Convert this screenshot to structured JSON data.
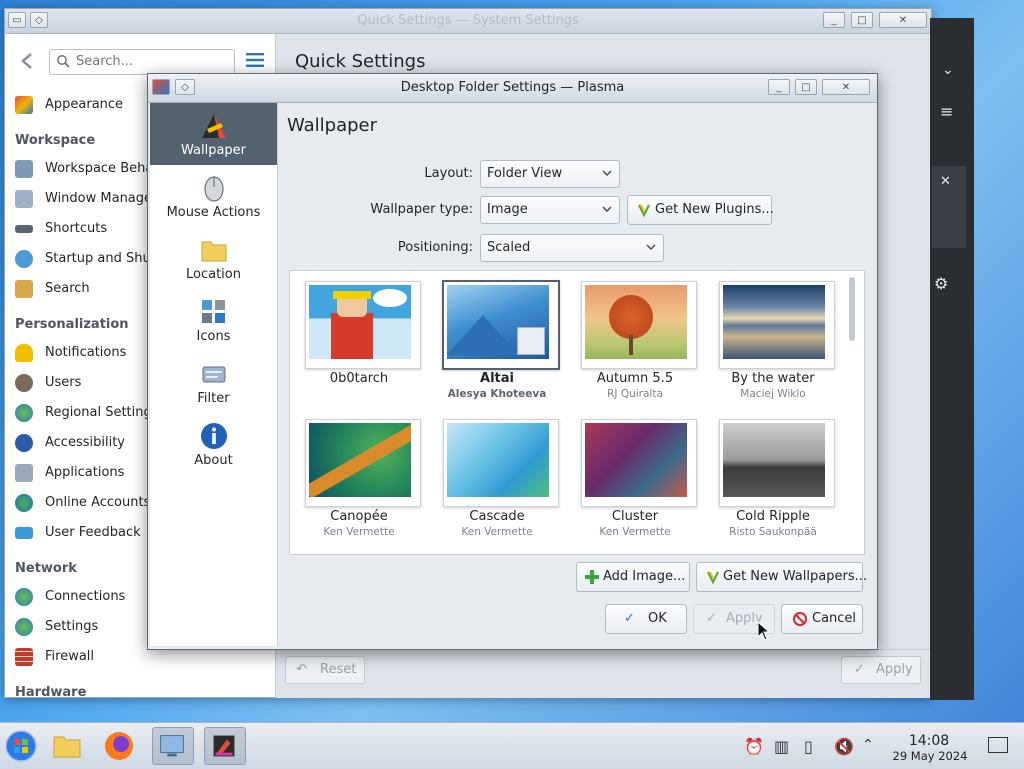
{
  "system_settings": {
    "title": "Quick Settings — System Settings",
    "search_placeholder": "Search...",
    "main_title": "Quick Settings",
    "top_item": "Appearance",
    "sections": [
      {
        "heading": "Workspace",
        "items": [
          "Workspace Behavior",
          "Window Management",
          "Shortcuts",
          "Startup and Shutdown",
          "Search"
        ]
      },
      {
        "heading": "Personalization",
        "items": [
          "Notifications",
          "Users",
          "Regional Settings",
          "Accessibility",
          "Applications",
          "Online Accounts",
          "User Feedback"
        ]
      },
      {
        "heading": "Network",
        "items": [
          "Connections",
          "Settings",
          "Firewall"
        ]
      },
      {
        "heading": "Hardware",
        "items": []
      }
    ],
    "reset_label": "Reset",
    "apply_label": "Apply"
  },
  "dialog": {
    "title": "Desktop Folder Settings — Plasma",
    "categories": [
      {
        "label": "Wallpaper",
        "icon": "wallpaper-icon",
        "selected": true
      },
      {
        "label": "Mouse Actions",
        "icon": "mouse-icon",
        "selected": false
      },
      {
        "label": "Location",
        "icon": "folder-icon",
        "selected": false
      },
      {
        "label": "Icons",
        "icon": "icons-icon",
        "selected": false
      },
      {
        "label": "Filter",
        "icon": "filter-icon",
        "selected": false
      },
      {
        "label": "About",
        "icon": "info-icon",
        "selected": false
      }
    ],
    "page_title": "Wallpaper",
    "layout_label": "Layout:",
    "layout_value": "Folder View",
    "type_label": "Wallpaper type:",
    "type_value": "Image",
    "get_plugins_label": "Get New Plugins...",
    "positioning_label": "Positioning:",
    "positioning_value": "Scaled",
    "wallpapers": [
      {
        "name": "0b0tarch",
        "author": "",
        "selected": false
      },
      {
        "name": "Altai",
        "author": "Alesya Khoteeva",
        "selected": true
      },
      {
        "name": "Autumn 5.5",
        "author": "RJ Quiralta",
        "selected": false
      },
      {
        "name": "By the water",
        "author": "Maciej Wiklo",
        "selected": false
      },
      {
        "name": "Canopée",
        "author": "Ken Vermette",
        "selected": false
      },
      {
        "name": "Cascade",
        "author": "Ken Vermette",
        "selected": false
      },
      {
        "name": "Cluster",
        "author": "Ken Vermette",
        "selected": false
      },
      {
        "name": "Cold Ripple",
        "author": "Risto Saukonpää",
        "selected": false
      }
    ],
    "add_image_label": "Add Image...",
    "get_wallpapers_label": "Get New Wallpapers...",
    "ok_label": "OK",
    "apply_label": "Apply",
    "cancel_label": "Cancel"
  },
  "taskbar": {
    "time": "14:08",
    "date": "29 May 2024"
  }
}
